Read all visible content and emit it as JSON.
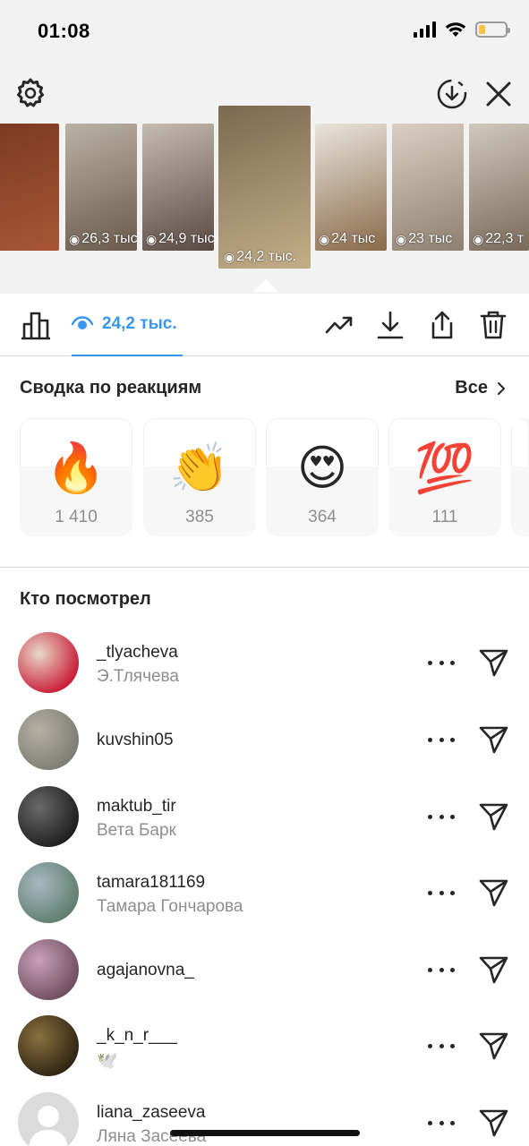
{
  "status_bar": {
    "time": "01:08",
    "battery_level": 0.25
  },
  "stories": [
    {
      "views": "",
      "colors": [
        "#7a3a22",
        "#a85636"
      ]
    },
    {
      "views": "26,3 тыс",
      "colors": [
        "#b9b2a4",
        "#6a5a4c"
      ]
    },
    {
      "views": "24,9 тыс",
      "colors": [
        "#c4bbb0",
        "#5a4a42"
      ]
    },
    {
      "views": "24,2 тыс.",
      "colors": [
        "#7b6a52",
        "#c2ae86"
      ],
      "selected": true
    },
    {
      "views": "24 тыс",
      "colors": [
        "#e8e4dc",
        "#8a6a4a"
      ]
    },
    {
      "views": "23 тыс",
      "colors": [
        "#d9cfc2",
        "#8e8070"
      ]
    },
    {
      "views": "22,3 т",
      "colors": [
        "#cfc8bc",
        "#7a6a5a"
      ]
    }
  ],
  "toolbar": {
    "views_count": "24,2 тыс.",
    "accent_color": "#3897f0"
  },
  "reactions": {
    "title": "Сводка по реакциям",
    "all_label": "Все",
    "items": [
      {
        "emoji": "🔥",
        "count": "1 410"
      },
      {
        "emoji": "👏",
        "count": "385"
      },
      {
        "emoji": "😍",
        "count": "364"
      },
      {
        "emoji": "💯",
        "count": "111"
      }
    ]
  },
  "viewers": {
    "title": "Кто посмотрел",
    "items": [
      {
        "username": "_tlyacheva",
        "name": "Э.Тлячева",
        "avatar_colors": [
          "#c8102e",
          "#e8d8c8"
        ]
      },
      {
        "username": "kuvshin05",
        "name": "",
        "avatar_colors": [
          "#7a7a72",
          "#b5b0a2"
        ]
      },
      {
        "username": "maktub_tir",
        "name": "Вета Барк",
        "avatar_colors": [
          "#1a1a1a",
          "#6a6a6a"
        ]
      },
      {
        "username": "tamara181169",
        "name": "Тамара Гончарова",
        "avatar_colors": [
          "#5a7a6a",
          "#a8b8c0"
        ]
      },
      {
        "username": "agajanovna_",
        "name": "",
        "avatar_colors": [
          "#6a4a5a",
          "#c8a0b8"
        ]
      },
      {
        "username": "_k_n_r___",
        "name": "🕊️",
        "avatar_colors": [
          "#2a2010",
          "#8a7040"
        ]
      },
      {
        "username": "liana_zaseeva",
        "name": "Ляна Засеева",
        "avatar_colors": [
          "#dbdbdb",
          "#efefef"
        ]
      }
    ]
  }
}
